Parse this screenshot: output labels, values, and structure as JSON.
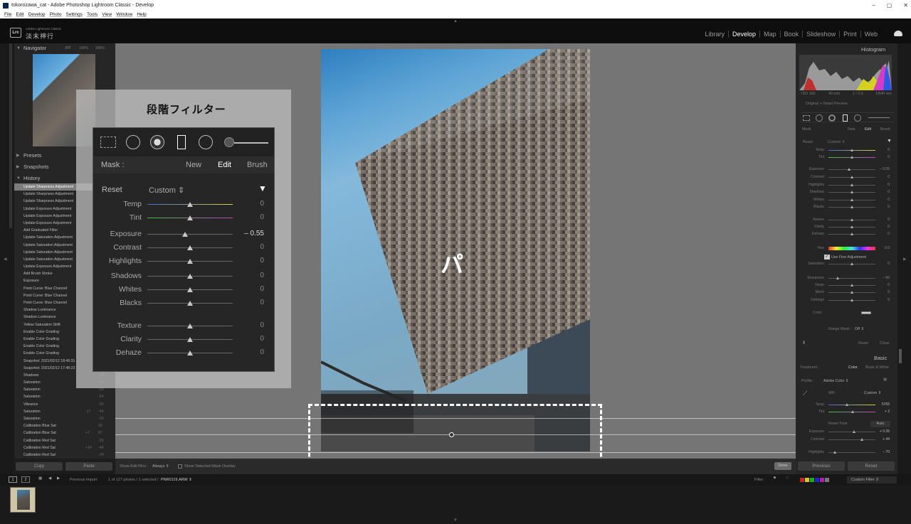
{
  "window": {
    "title": "tokorozawa_cat - Adobe Photoshop Lightroom Classic - Develop",
    "min": "–",
    "max": "▢",
    "close": "✕"
  },
  "menu": [
    "File",
    "Edit",
    "Develop",
    "Photo",
    "Settings",
    "Tools",
    "View",
    "Window",
    "Help"
  ],
  "identity": {
    "logo": "Lrc",
    "small": "Adobe Lightroom Classic",
    "name": "淡末神行"
  },
  "modules": [
    "Library",
    "Develop",
    "Map",
    "Book",
    "Slideshow",
    "Print",
    "Web"
  ],
  "active_module": "Develop",
  "left": {
    "navigator": {
      "title": "Navigator",
      "fit": "FIT",
      "z1": "100%",
      "z2": "300%"
    },
    "presets": "Presets",
    "snapshots": "Snapshots",
    "history_title": "History",
    "history": [
      {
        "label": "Update Sharpness Adjustment",
        "a": "",
        "b": ""
      },
      {
        "label": "Update Sharpness Adjustment",
        "a": "",
        "b": ""
      },
      {
        "label": "Update Sharpness Adjustment",
        "a": "",
        "b": ""
      },
      {
        "label": "Update Exposure Adjustment",
        "a": "",
        "b": ""
      },
      {
        "label": "Update Exposure Adjustment",
        "a": "",
        "b": ""
      },
      {
        "label": "Update Exposure Adjustment",
        "a": "",
        "b": ""
      },
      {
        "label": "Add Graduated Filter",
        "a": "",
        "b": ""
      },
      {
        "label": "Update Saturation Adjustment",
        "a": "",
        "b": ""
      },
      {
        "label": "Update Saturation Adjustment",
        "a": "",
        "b": ""
      },
      {
        "label": "Update Saturation Adjustment",
        "a": "",
        "b": ""
      },
      {
        "label": "Update Saturation Adjustment",
        "a": "",
        "b": ""
      },
      {
        "label": "Update Exposure Adjustment",
        "a": "",
        "b": ""
      },
      {
        "label": "Add Brush Stroke",
        "a": "",
        "b": ""
      },
      {
        "label": "Exposure",
        "a": "",
        "b": ""
      },
      {
        "label": "Point Curve: Blue Channel",
        "a": "",
        "b": ""
      },
      {
        "label": "Point Curve: Blue Channel",
        "a": "",
        "b": ""
      },
      {
        "label": "Point Curve: Blue Channel",
        "a": "",
        "b": ""
      },
      {
        "label": "Shadow Luminance",
        "a": "",
        "b": ""
      },
      {
        "label": "Shadow Luminance",
        "a": "",
        "b": ""
      },
      {
        "label": "Yellow Saturation Shift",
        "a": "",
        "b": ""
      },
      {
        "label": "Enable Color Grading",
        "a": "",
        "b": ""
      },
      {
        "label": "Enable Color Grading",
        "a": "",
        "b": ""
      },
      {
        "label": "Enable Color Grading",
        "a": "",
        "b": ""
      },
      {
        "label": "Enable Color Grading",
        "a": "",
        "b": ""
      },
      {
        "label": "Snapshot: 2021/02/12 18:49:31",
        "a": "",
        "b": ""
      },
      {
        "label": "Snapshot: 2021/02/12 17:48:23",
        "a": "",
        "b": ""
      },
      {
        "label": "Shadows",
        "a": "",
        "b": "-18"
      },
      {
        "label": "Saturation",
        "a": "",
        "b": "-61"
      },
      {
        "label": "Saturation",
        "a": "",
        "b": "-33"
      },
      {
        "label": "Saturation",
        "a": "",
        "b": "-64"
      },
      {
        "label": "Vibrance",
        "a": "",
        "b": "-28"
      },
      {
        "label": "Saturation",
        "a": "-17",
        "b": "-40"
      },
      {
        "label": "Saturation",
        "a": "",
        "b": "-20"
      },
      {
        "label": "Calibration Blue Sat",
        "a": "",
        "b": "30"
      },
      {
        "label": "Calibration Blue Sat",
        "a": "+7",
        "b": "87"
      },
      {
        "label": "Calibration Red Sat",
        "a": "",
        "b": "-35"
      },
      {
        "label": "Calibration Red Sat",
        "a": "+14",
        "b": "-48"
      },
      {
        "label": "Calibration Red Sat",
        "a": "",
        "b": "-34"
      }
    ],
    "copy": "Copy",
    "paste": "Paste"
  },
  "overlay": {
    "title": "段階フィルター",
    "mask_label": "Mask :",
    "new": "New",
    "edit": "Edit",
    "brush": "Brush",
    "reset": "Reset",
    "preset": "Custom ⇕",
    "sliders": [
      {
        "label": "Temp",
        "value": "0",
        "pos": 0.5,
        "track": "temp"
      },
      {
        "label": "Tint",
        "value": "0",
        "pos": 0.5,
        "track": "tint"
      },
      {
        "label": "Exposure",
        "value": "– 0.55",
        "pos": 0.44,
        "track": "plain"
      },
      {
        "label": "Contrast",
        "value": "0",
        "pos": 0.5,
        "track": "plain"
      },
      {
        "label": "Highlights",
        "value": "0",
        "pos": 0.5,
        "track": "plain"
      },
      {
        "label": "Shadows",
        "value": "0",
        "pos": 0.5,
        "track": "plain"
      },
      {
        "label": "Whites",
        "value": "0",
        "pos": 0.5,
        "track": "plain"
      },
      {
        "label": "Blacks",
        "value": "0",
        "pos": 0.5,
        "track": "plain"
      },
      {
        "label": "Texture",
        "value": "0",
        "pos": 0.5,
        "track": "plain"
      },
      {
        "label": "Clarity",
        "value": "0",
        "pos": 0.5,
        "track": "plain"
      },
      {
        "label": "Dehaze",
        "value": "0",
        "pos": 0.5,
        "track": "plain"
      }
    ]
  },
  "photo": {
    "watermark": "パ"
  },
  "center_toolbar": {
    "show_pins": "Show Edit Pins :",
    "pins_value": "Always ⇕",
    "overlay": "Show Selected Mask Overlay",
    "done": "Done"
  },
  "right": {
    "histogram": "Histogram",
    "exif": [
      "ISO 100",
      "40 mm",
      "ƒ / 2.0",
      "1/640 sec"
    ],
    "preview": "Original + Smart Preview",
    "mask_label": "Mask",
    "new": "New",
    "edit": "Edit",
    "brush": "Brush",
    "reset": "Reset",
    "preset": "Custom ⇕",
    "sliders": [
      {
        "label": "Temp",
        "value": "0",
        "pos": 0.5
      },
      {
        "label": "Tint",
        "value": "0",
        "pos": 0.5
      },
      {
        "label": "Exposure",
        "value": "– 0.55",
        "pos": 0.44
      },
      {
        "label": "Contrast",
        "value": "0",
        "pos": 0.5
      },
      {
        "label": "Highlights",
        "value": "0",
        "pos": 0.5
      },
      {
        "label": "Shadows",
        "value": "0",
        "pos": 0.5
      },
      {
        "label": "Whites",
        "value": "0",
        "pos": 0.5
      },
      {
        "label": "Blacks",
        "value": "0",
        "pos": 0.5
      },
      {
        "label": "Texture",
        "value": "0",
        "pos": 0.5
      },
      {
        "label": "Clarity",
        "value": "0",
        "pos": 0.5
      },
      {
        "label": "Dehaze",
        "value": "0",
        "pos": 0.5
      },
      {
        "label": "Hue",
        "value": "0.0",
        "pos": 0.5
      },
      {
        "label": "Saturation",
        "value": "0",
        "pos": 0.5
      },
      {
        "label": "Sharpness",
        "value": "– 60",
        "pos": 0.2
      },
      {
        "label": "Noise",
        "value": "0",
        "pos": 0.5
      },
      {
        "label": "Moiré",
        "value": "0",
        "pos": 0.5
      },
      {
        "label": "Defringe",
        "value": "0",
        "pos": 0.5
      }
    ],
    "use_fine": "Use Fine Adjustment",
    "color": "Color",
    "range_mask": "Range Mask :",
    "range_val": "Off ⇕",
    "reset_btn": "Reset",
    "close_btn": "Close",
    "basic": "Basic",
    "treatment": "Treatment :",
    "t_color": "Color",
    "t_bw": "Black & White",
    "profile": "Profile :",
    "profile_val": "Adobe Color ⇕",
    "wb": "WB :",
    "wb_val": "Custom ⇕",
    "basic_sliders": [
      {
        "label": "Temp",
        "value": "5765",
        "pos": 0.4
      },
      {
        "label": "Tint",
        "value": "+ 2",
        "pos": 0.52
      },
      {
        "label": "Exposure",
        "value": "+ 0.35",
        "pos": 0.55
      },
      {
        "label": "Contrast",
        "value": "+ 44",
        "pos": 0.72
      },
      {
        "label": "Highlights",
        "value": "– 70",
        "pos": 0.15
      }
    ],
    "reset_tone": "Reset Tone",
    "auto": "Auto",
    "previous": "Previous",
    "reset2": "Reset"
  },
  "filmstrip": {
    "n1": "1",
    "n2": "2",
    "prev_import": "Previous Import",
    "count": "1 of 127 photos / 1 selected /",
    "filename": "PNR0119.ARW ⇕",
    "filter": "Filter :",
    "custom": "Custom Filter ⇕"
  }
}
